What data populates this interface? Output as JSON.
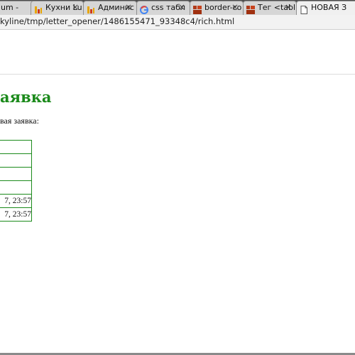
{
  "browser": {
    "tabs": [
      {
        "title": "um - ",
        "close": "×",
        "icon": "generic-tab-icon"
      },
      {
        "title": "Кухни Lu",
        "close": "×",
        "icon": "yellow-bars-icon"
      },
      {
        "title": "Админис",
        "close": "×",
        "icon": "yellow-bars-icon"
      },
      {
        "title": "css табл",
        "close": "×",
        "icon": "google-g-icon"
      },
      {
        "title": "border-co",
        "close": "×",
        "icon": "red-squares-icon"
      },
      {
        "title": "Тег <tabl",
        "close": "×",
        "icon": "red-squares-icon"
      },
      {
        "title": "НОВАЯ З",
        "close": "×",
        "icon": "document-icon"
      }
    ],
    "address": "kyline/tmp/letter_opener/1486155471_93348c4/rich.html"
  },
  "page": {
    "heading": "аявка",
    "intro": "вая заявка:",
    "table_rows": [
      "",
      "",
      "",
      "",
      "7, 23:57",
      "7, 23:57"
    ]
  },
  "colors": {
    "accent_green": "#1b8a1b",
    "tab_bg": "#d6d6d6",
    "tabstrip_bg": "#4c4c4c"
  }
}
